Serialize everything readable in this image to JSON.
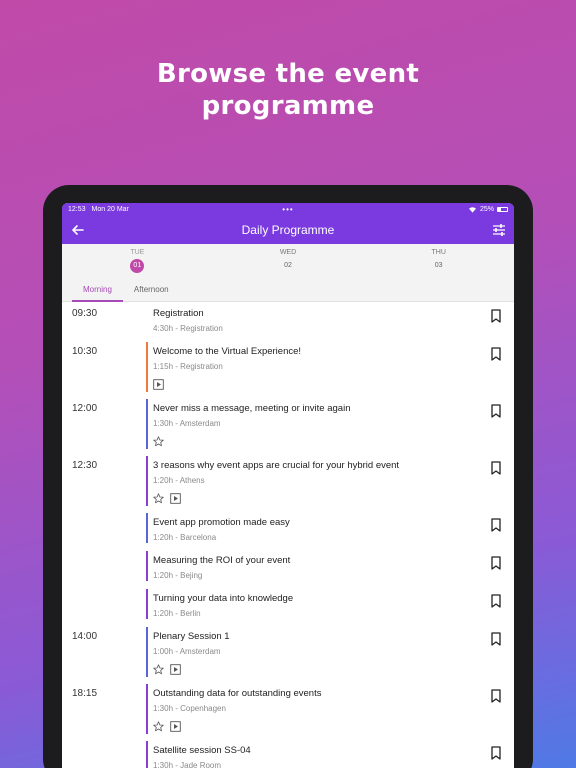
{
  "headline": {
    "line1": "Browse the event",
    "line2": "programme"
  },
  "status_bar": {
    "time": "12:53",
    "date": "Mon 20 Mar",
    "dots": "•••",
    "battery": "25%"
  },
  "app_bar": {
    "title": "Daily Programme",
    "back_icon": "arrow-left-icon",
    "filter_icon": "sliders-icon"
  },
  "days": [
    {
      "name": "TUE",
      "num": "01",
      "active": true
    },
    {
      "name": "WED",
      "num": "02",
      "active": false
    },
    {
      "name": "THU",
      "num": "03",
      "active": false
    }
  ],
  "tabs": [
    {
      "label": "Morning",
      "active": true
    },
    {
      "label": "Afternoon",
      "active": false
    }
  ],
  "colors": {
    "accent": "#7a3ae0",
    "active_day": "#c04aa8",
    "tab_active": "#a64ab6",
    "bar_orange": "#f07a3c",
    "bar_blue": "#5866d8",
    "bar_purple": "#8a3fd0"
  },
  "sessions": [
    {
      "time": "09:30",
      "title": "Registration",
      "sub": "4:30h - Registration",
      "bar": "",
      "icons": []
    },
    {
      "time": "10:30",
      "title": "Welcome to the Virtual Experience!",
      "sub": "1:15h - Registration",
      "bar": "orange",
      "icons": [
        "play-icon"
      ]
    },
    {
      "time": "12:00",
      "title": "Never miss a message, meeting or invite again",
      "sub": "1:30h - Amsterdam",
      "bar": "blue",
      "icons": [
        "star-icon"
      ]
    },
    {
      "time": "12:30",
      "title": "3 reasons why event apps are crucial for your hybrid event",
      "sub": "1:20h - Athens",
      "bar": "purple",
      "icons": [
        "star-icon",
        "play-icon"
      ]
    },
    {
      "time": "",
      "title": "Event app promotion made easy",
      "sub": "1:20h - Barcelona",
      "bar": "blue",
      "icons": []
    },
    {
      "time": "",
      "title": "Measuring the ROI of your event",
      "sub": "1:20h - Bejing",
      "bar": "purple",
      "icons": []
    },
    {
      "time": "",
      "title": "Turning your data into knowledge",
      "sub": "1:20h - Berlin",
      "bar": "purple",
      "icons": []
    },
    {
      "time": "14:00",
      "title": "Plenary Session 1",
      "sub": "1:00h - Amsterdam",
      "bar": "blue",
      "icons": [
        "star-icon",
        "play-icon"
      ]
    },
    {
      "time": "18:15",
      "title": "Outstanding data for outstanding events",
      "sub": "1:30h - Copenhagen",
      "bar": "purple",
      "icons": [
        "star-icon",
        "play-icon"
      ]
    },
    {
      "time": "",
      "title": "Satellite session SS-04",
      "sub": "1:30h - Jade Room",
      "bar": "purple",
      "icons": []
    }
  ]
}
